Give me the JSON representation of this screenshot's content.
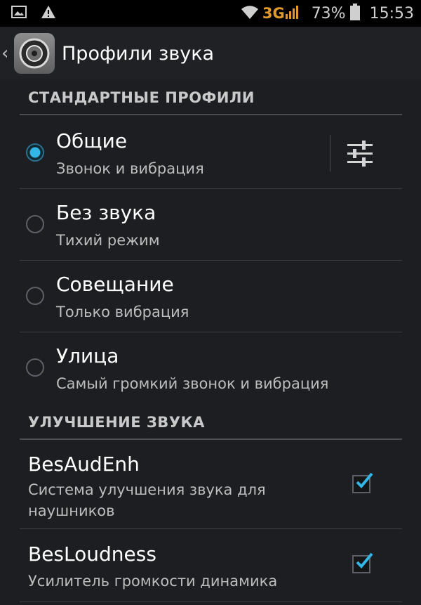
{
  "status_bar": {
    "network": "3G",
    "battery": "73%",
    "time": "15:53",
    "icons": [
      "image-icon",
      "warning-icon",
      "wifi-icon",
      "signal-icon",
      "battery-icon"
    ]
  },
  "action_bar": {
    "title": "Профили звука",
    "icon": "sound-profiles-app-icon"
  },
  "sections": {
    "standard": {
      "header": "СТАНДАРТНЫЕ ПРОФИЛИ"
    },
    "enhance": {
      "header": "УЛУЧШЕНИЕ ЗВУКА"
    }
  },
  "profiles": [
    {
      "title": "Общие",
      "subtitle": "Звонок и вибрация",
      "selected": true
    },
    {
      "title": "Без звука",
      "subtitle": "Тихий режим",
      "selected": false
    },
    {
      "title": "Совещание",
      "subtitle": "Только вибрация",
      "selected": false
    },
    {
      "title": "Улица",
      "subtitle": "Самый громкий звонок и вибрация",
      "selected": false
    }
  ],
  "enhancements": [
    {
      "title": "BesAudEnh",
      "subtitle": "Система улучшения звука для наушников",
      "checked": true
    },
    {
      "title": "BesLoudness",
      "subtitle": "Усилитель громкости динамика",
      "checked": true
    }
  ],
  "colors": {
    "accent": "#33b5e5",
    "background": "#1c1e21",
    "network": "#e09a2a"
  }
}
